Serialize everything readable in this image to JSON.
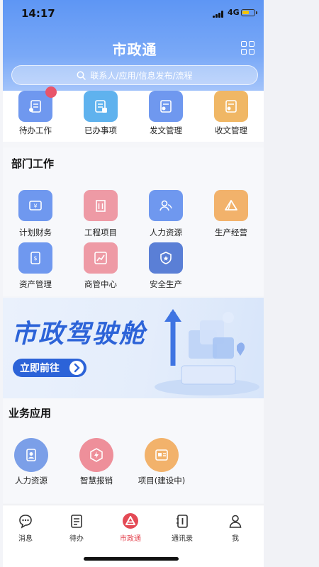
{
  "status_bar": {
    "time": "14:17",
    "network": "4G"
  },
  "app": {
    "title": "市政通"
  },
  "search": {
    "placeholder": "联系人/应用/信息发布/流程"
  },
  "quick_actions": [
    {
      "label": "待办工作",
      "color": "#6f98ef"
    },
    {
      "label": "已办事项",
      "color": "#5fb2ee"
    },
    {
      "label": "发文管理",
      "color": "#6f98ef"
    },
    {
      "label": "收文管理",
      "color": "#f0b765"
    }
  ],
  "dept_section": {
    "title": "部门工作",
    "items": [
      {
        "label": "计划财务",
        "color": "#6f98ef",
        "icon": "finance-icon"
      },
      {
        "label": "工程项目",
        "color": "#ee9aa5",
        "icon": "building-icon"
      },
      {
        "label": "人力资源",
        "color": "#6f98ef",
        "icon": "people-icon"
      },
      {
        "label": "生产经营",
        "color": "#f2b26b",
        "icon": "triangle-icon"
      },
      {
        "label": "资产管理",
        "color": "#6f98ef",
        "icon": "asset-icon"
      },
      {
        "label": "商管中心",
        "color": "#ee9aa5",
        "icon": "chart-icon"
      },
      {
        "label": "安全生产",
        "color": "#5a7fd6",
        "icon": "shield-icon"
      }
    ]
  },
  "banner": {
    "title": "市政驾驶舱",
    "button": "立即前往"
  },
  "biz_section": {
    "title": "业务应用",
    "items": [
      {
        "label": "人力资源",
        "color": "#7b9fe8",
        "icon": "badge-icon"
      },
      {
        "label": "智慧报销",
        "color": "#ee8f9a",
        "icon": "bolt-icon"
      },
      {
        "label": "项目(建设中)",
        "color": "#f2b26b",
        "icon": "card-icon"
      }
    ]
  },
  "tabbar": [
    {
      "label": "消息",
      "icon": "chat-icon"
    },
    {
      "label": "待办",
      "icon": "list-icon"
    },
    {
      "label": "市政通",
      "icon": "logo-icon",
      "active": true
    },
    {
      "label": "通讯录",
      "icon": "contacts-icon"
    },
    {
      "label": "我",
      "icon": "user-icon"
    }
  ],
  "colors": {
    "accent": "#2c63d8",
    "header": "#5e96f4",
    "active_tab": "#e44a55"
  }
}
